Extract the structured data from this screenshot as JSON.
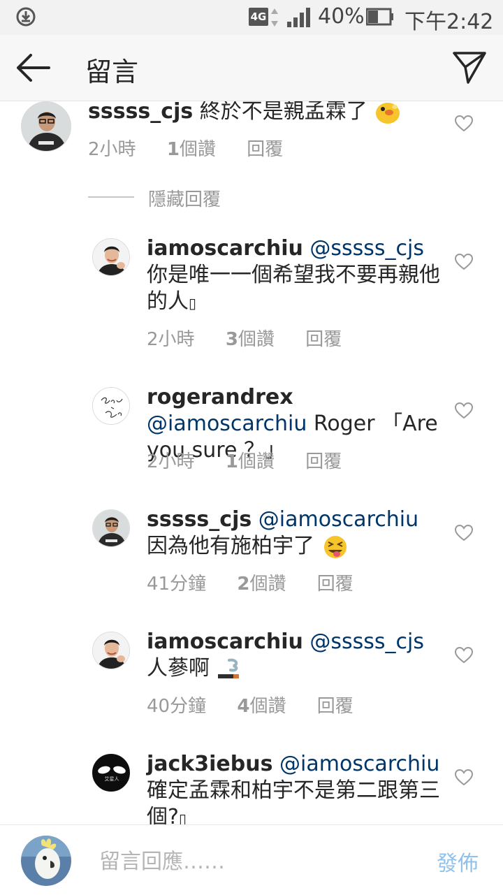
{
  "status_bar": {
    "network": "4G",
    "battery_percent": "40%",
    "time": "下午2:42"
  },
  "header": {
    "title": "留言",
    "back_icon": "arrow-left-icon",
    "send_icon": "paper-plane-icon"
  },
  "top_comment": {
    "username": "sssss_cjs",
    "text": " 終於不是親孟霖了",
    "emoji": "hatching-chick",
    "time": "2小時",
    "likes_count": "1",
    "likes_suffix": "個讚",
    "reply_label": "回覆"
  },
  "hide_replies_label": "隱藏回覆",
  "replies": [
    {
      "username": "iamoscarchiu",
      "mention": "@sssss_cjs",
      "text": " 你是唯一一個希望我不要再親他的人",
      "trailing_glyph": "▯",
      "time": "2小時",
      "likes_count": "3",
      "likes_suffix": "個讚",
      "reply_label": "回覆"
    },
    {
      "username": "rogerandrex",
      "mention": "@iamoscarchiu",
      "text": " Roger 「Are you sure ？」",
      "time": "2小時",
      "likes_count": "1",
      "likes_suffix": "個讚",
      "reply_label": "回覆"
    },
    {
      "username": "sssss_cjs",
      "mention": "@iamoscarchiu",
      "text": " 因為他有施柏宇了",
      "emoji": "squinting-tongue-face",
      "time": "41分鐘",
      "likes_count": "2",
      "likes_suffix": "個讚",
      "reply_label": "回覆"
    },
    {
      "username": "iamoscarchiu",
      "mention": "@sssss_cjs",
      "text": " 人蔘啊",
      "emoji": "smoking-cigarette",
      "time": "40分鐘",
      "likes_count": "4",
      "likes_suffix": "個讚",
      "reply_label": "回覆"
    },
    {
      "username": "jack3iebus",
      "mention": "@iamoscarchiu",
      "text": " 確定孟霖和柏宇不是第二跟第三個?",
      "trailing_glyph": "▯"
    }
  ],
  "avatar_texts": {
    "roger_sig": "Roger & Rex",
    "jack_mark": "艾星人"
  },
  "input": {
    "placeholder": "留言回應……",
    "post_label": "發佈"
  },
  "colors": {
    "mention": "#003569",
    "meta": "#999999",
    "post_button": "#8fc1ec",
    "header_bg": "#f7f7f7"
  }
}
